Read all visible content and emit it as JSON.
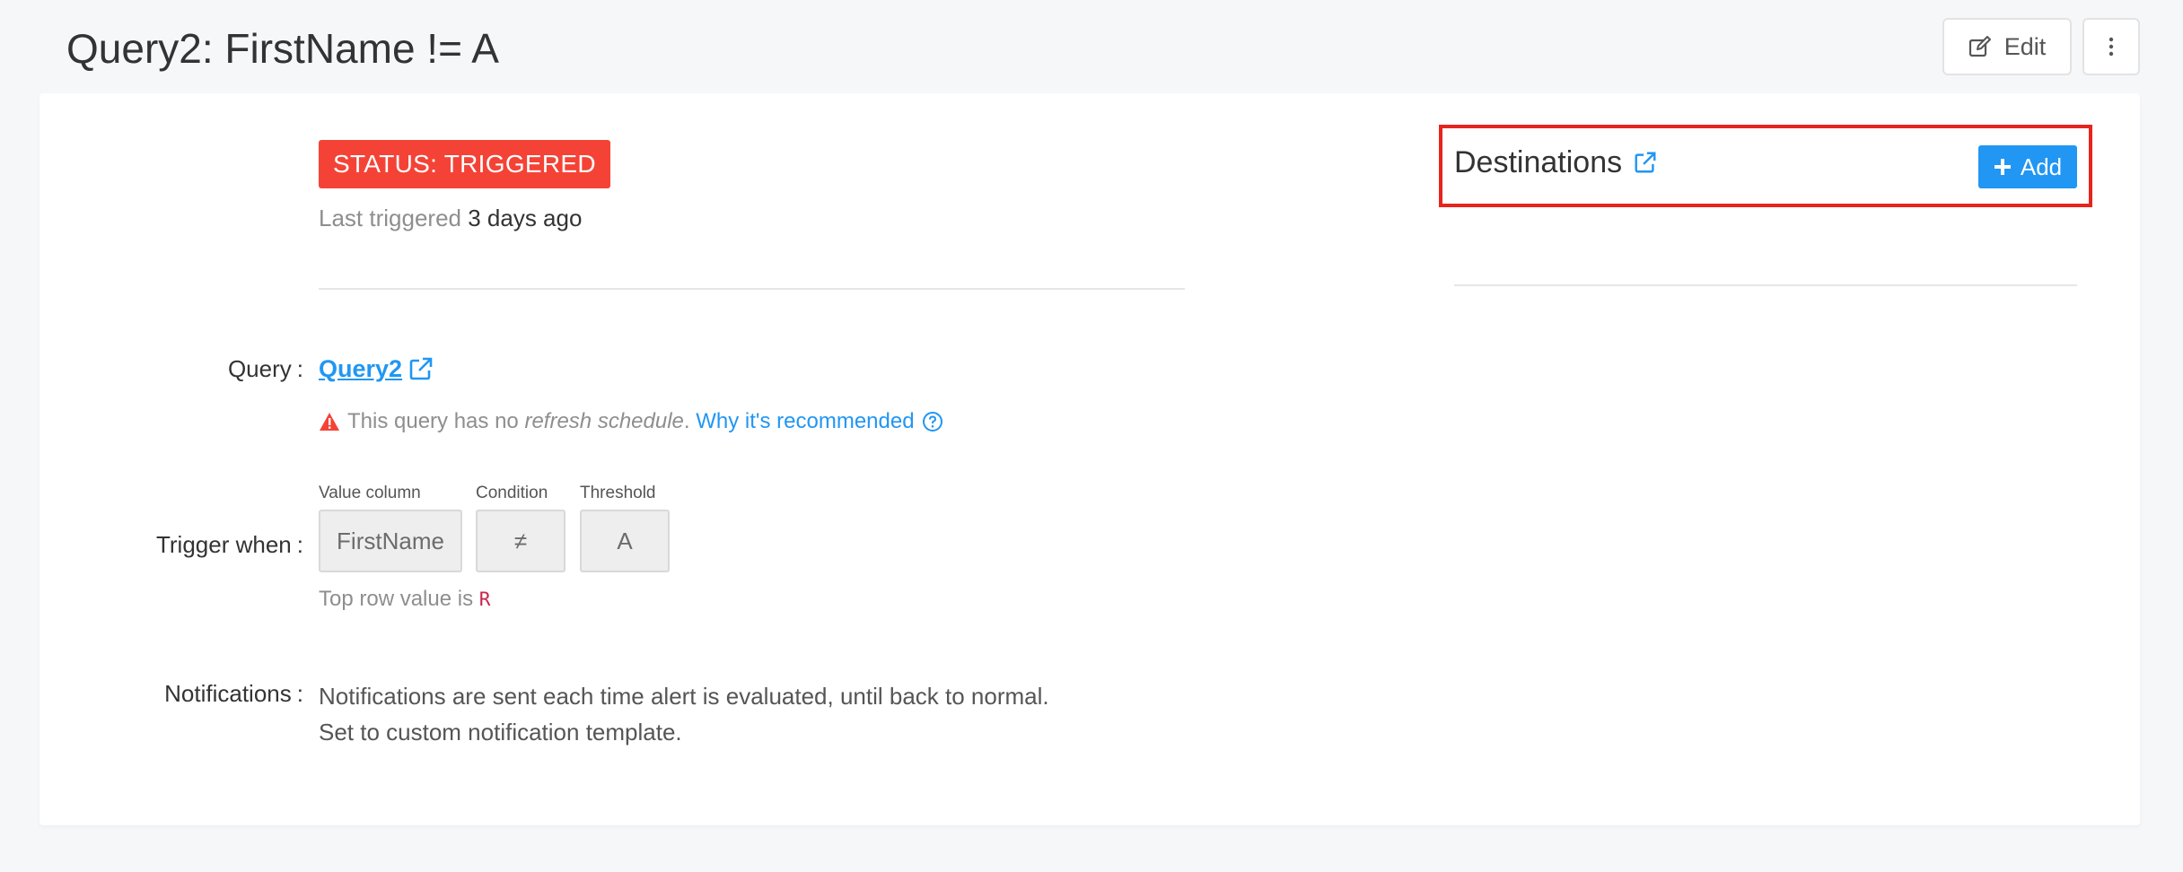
{
  "header": {
    "title": "Query2: FirstName != A",
    "edit_label": "Edit",
    "more_icon": "vertical-ellipsis-icon"
  },
  "status": {
    "badge": "STATUS: TRIGGERED",
    "badge_color": "#f44336",
    "last_triggered_label": "Last triggered",
    "last_triggered_value": "3 days ago"
  },
  "query_row": {
    "label": "Query",
    "link_text": "Query2",
    "warning_prefix": "This query has no",
    "warning_emphasis": "refresh schedule",
    "warning_suffix": ".",
    "warning_link": "Why it's recommended"
  },
  "trigger_row": {
    "label": "Trigger when",
    "value_column_caption": "Value column",
    "value_column": "FirstName",
    "condition_caption": "Condition",
    "condition": "≠",
    "threshold_caption": "Threshold",
    "threshold": "A",
    "top_row_label": "Top row value is",
    "top_row_value": "R"
  },
  "notifications_row": {
    "label": "Notifications",
    "line1": "Notifications are sent each time alert is evaluated, until back to normal.",
    "line2": "Set to custom notification template."
  },
  "destinations": {
    "title": "Destinations",
    "add_label": "Add",
    "highlight_color": "#e6251e",
    "accent_color": "#2196f3"
  }
}
